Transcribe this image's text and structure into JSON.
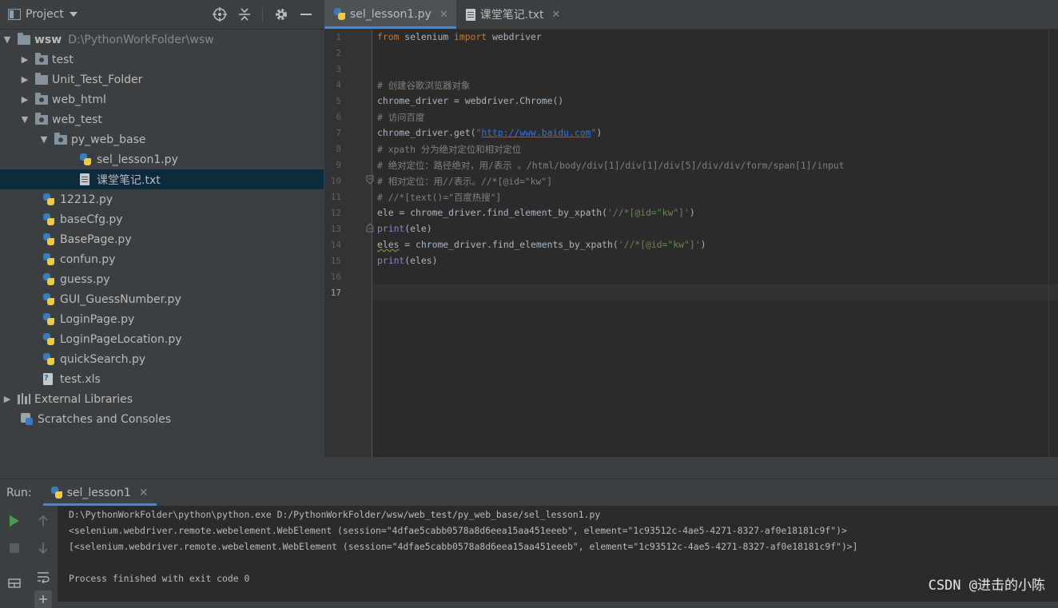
{
  "project_panel": {
    "title": "Project",
    "tree": [
      {
        "label": "wsw",
        "path": "D:\\PythonWorkFolder\\wsw",
        "type": "folder",
        "expanded": true
      },
      {
        "label": "test",
        "type": "package",
        "expanded": false
      },
      {
        "label": "Unit_Test_Folder",
        "type": "folder",
        "expanded": false
      },
      {
        "label": "web_html",
        "type": "package",
        "expanded": false
      },
      {
        "label": "web_test",
        "type": "package",
        "expanded": true
      },
      {
        "label": "py_web_base",
        "type": "package",
        "expanded": true
      },
      {
        "label": "sel_lesson1.py",
        "type": "python"
      },
      {
        "label": "课堂笔记.txt",
        "type": "text",
        "selected": true
      },
      {
        "label": "12212.py",
        "type": "python"
      },
      {
        "label": "baseCfg.py",
        "type": "python"
      },
      {
        "label": "BasePage.py",
        "type": "python"
      },
      {
        "label": "confun.py",
        "type": "python"
      },
      {
        "label": "guess.py",
        "type": "python"
      },
      {
        "label": "GUI_GuessNumber.py",
        "type": "python"
      },
      {
        "label": "LoginPage.py",
        "type": "python"
      },
      {
        "label": "LoginPageLocation.py",
        "type": "python"
      },
      {
        "label": "quickSearch.py",
        "type": "python"
      },
      {
        "label": "test.xls",
        "type": "excel"
      },
      {
        "label": "External Libraries",
        "type": "libraries",
        "expanded": false
      },
      {
        "label": "Scratches and Consoles",
        "type": "scratches"
      }
    ]
  },
  "editor": {
    "tabs": [
      {
        "label": "sel_lesson1.py",
        "active": true
      },
      {
        "label": "课堂笔记.txt",
        "active": false
      }
    ],
    "lines": [
      "from selenium import webdriver",
      "",
      "",
      "# 创建谷歌浏览器对象",
      "chrome_driver = webdriver.Chrome()",
      "# 访问百度",
      "chrome_driver.get(\"http://www.baidu.com\")",
      "# xpath 分为绝对定位和相对定位",
      "# 绝对定位：路径绝对，用/表示 。/html/body/div[1]/div[1]/div[5]/div/div/form/span[1]/input",
      "# 相对定位：用//表示。//*[@id=\"kw\"]",
      "# //*[text()=\"百度热搜\"]",
      "ele = chrome_driver.find_element_by_xpath('//*[@id=\"kw\"]')",
      "print(ele)",
      "eles = chrome_driver.find_elements_by_xpath('//*[@id=\"kw\"]')",
      "print(eles)",
      "",
      ""
    ],
    "line_numbers": [
      "1",
      "2",
      "3",
      "4",
      "5",
      "6",
      "7",
      "8",
      "9",
      "10",
      "11",
      "12",
      "13",
      "14",
      "15",
      "16",
      "17"
    ],
    "current_line": "17"
  },
  "run_panel": {
    "label": "Run:",
    "tab": "sel_lesson1",
    "output": [
      "D:\\PythonWorkFolder\\python\\python.exe D:/PythonWorkFolder/wsw/web_test/py_web_base/sel_lesson1.py",
      "<selenium.webdriver.remote.webelement.WebElement (session=\"4dfae5cabb0578a8d6eea15aa451eeeb\", element=\"1c93512c-4ae5-4271-8327-af0e18181c9f\")>",
      "[<selenium.webdriver.remote.webelement.WebElement (session=\"4dfae5cabb0578a8d6eea15aa451eeeb\", element=\"1c93512c-4ae5-4271-8327-af0e18181c9f\")>]",
      "",
      "Process finished with exit code 0"
    ]
  },
  "watermark": "CSDN @进击的小陈",
  "colors": {
    "keyword": "#cc7832",
    "comment": "#808080",
    "string": "#6a8759",
    "url": "#287bde",
    "builtin": "#8888c6",
    "selection": "#0d293e",
    "tab_accent": "#4a88c7"
  }
}
